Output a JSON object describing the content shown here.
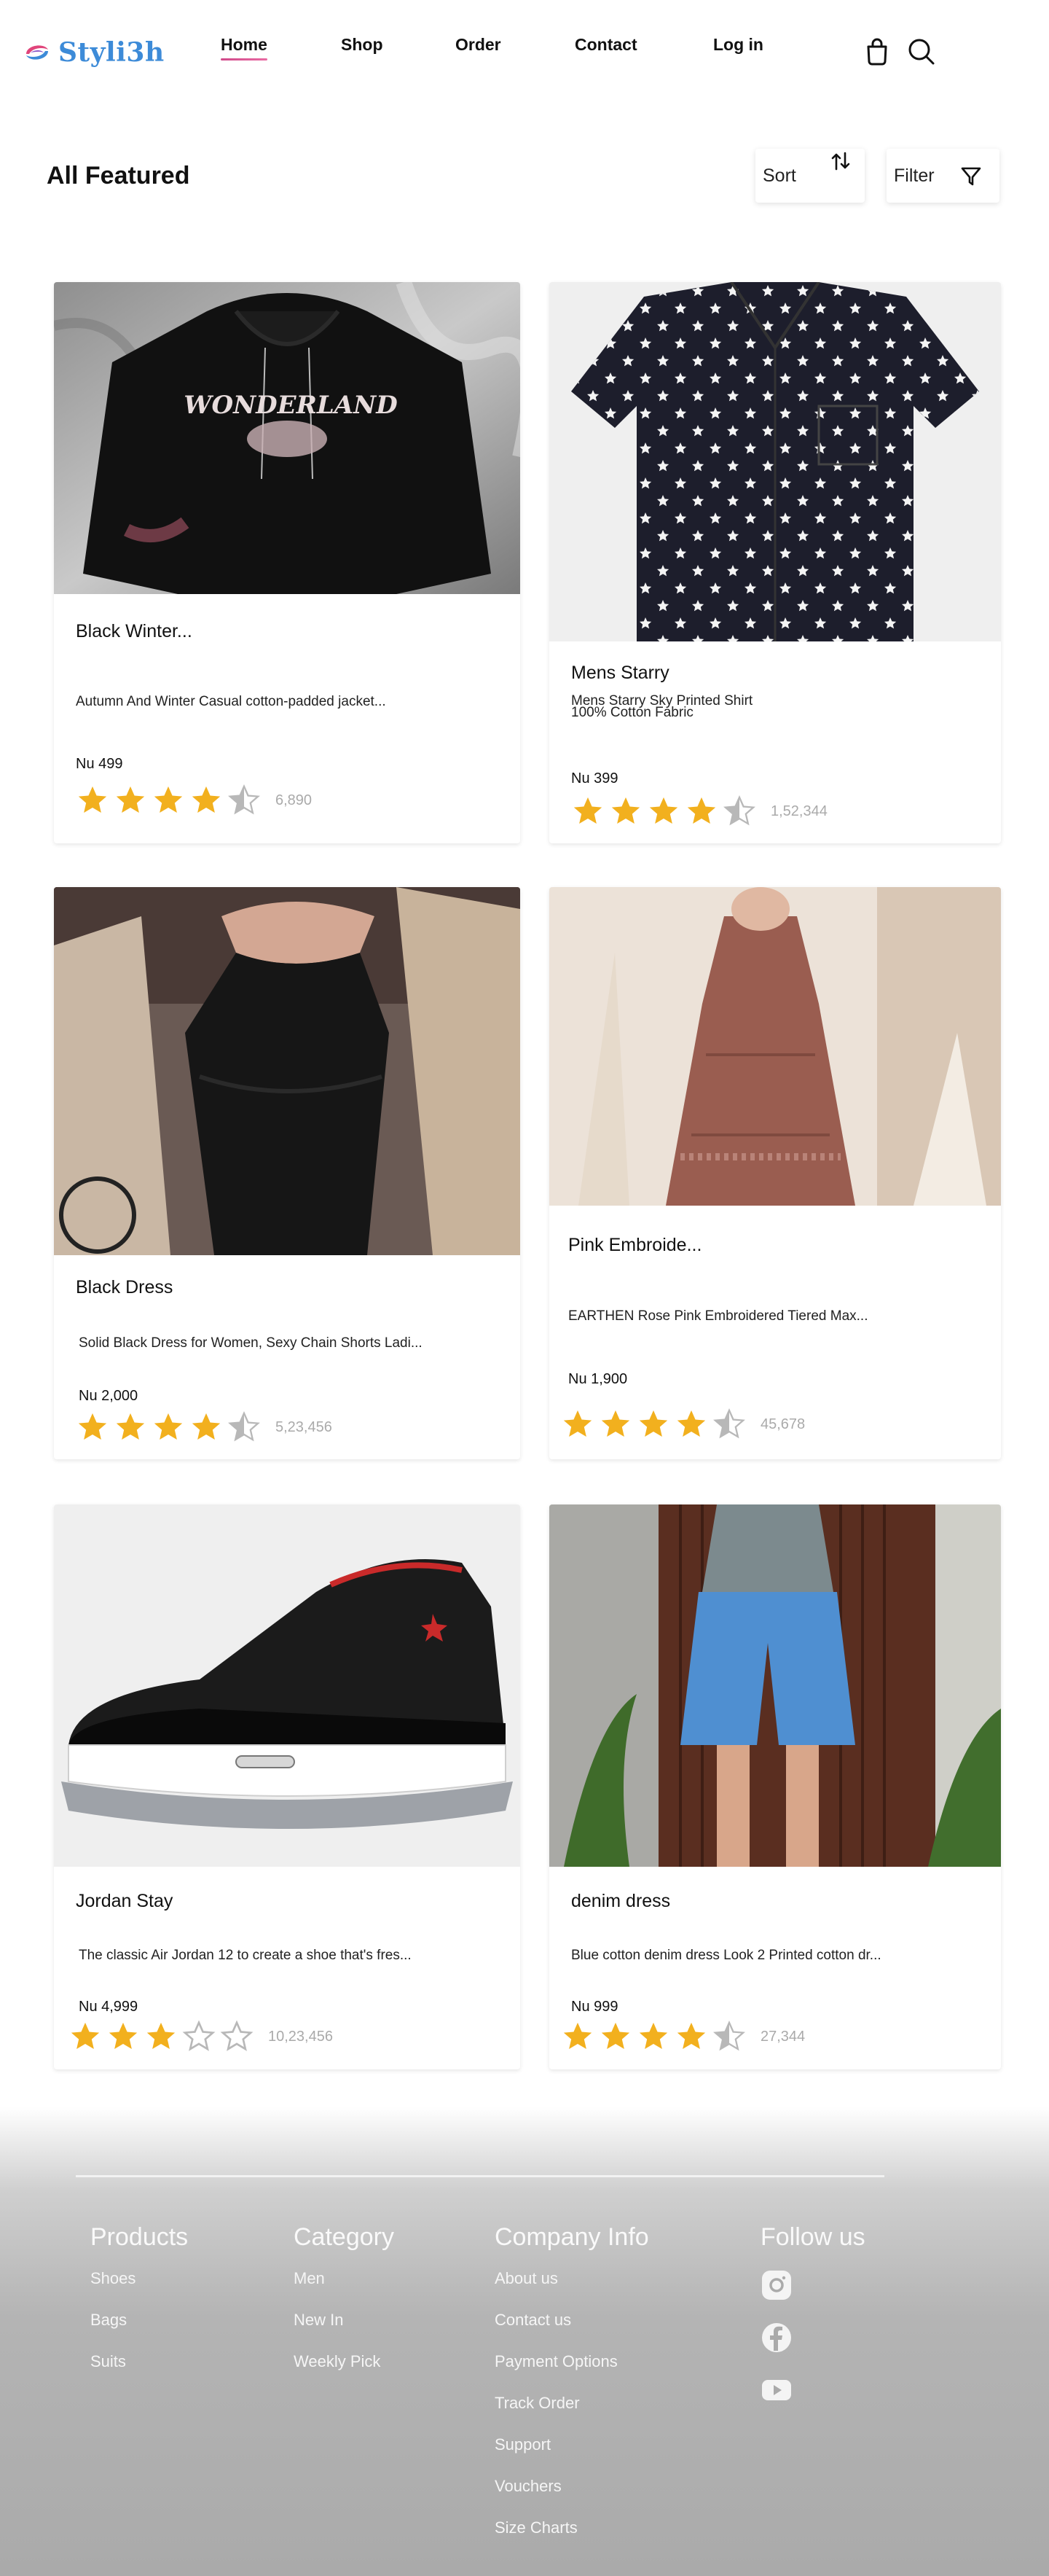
{
  "brand": {
    "name": "Styli3h"
  },
  "nav": {
    "links": [
      {
        "label": "Home",
        "active": true
      },
      {
        "label": "Shop"
      },
      {
        "label": "Order"
      },
      {
        "label": "Contact"
      },
      {
        "label": "Log in"
      }
    ],
    "icons": [
      "shopping-bag-icon",
      "search-icon"
    ]
  },
  "page": {
    "title": "All Featured"
  },
  "controls": {
    "sort_label": "Sort",
    "filter_label": "Filter"
  },
  "colors": {
    "brand": "#3d8bd8",
    "accent": "#d04a8a",
    "star": "#f2b01e",
    "star_empty": "#b8b8b8"
  },
  "products": [
    {
      "title": "Black Winter...",
      "description": "Autumn And Winter Casual cotton-padded jacket...",
      "price": "Nu 499",
      "rating": 4.5,
      "reviews": "6,890"
    },
    {
      "title": "Mens Starry",
      "description": "Mens Starry Sky Printed Shirt",
      "description2": "100% Cotton Fabric",
      "price": "Nu 399",
      "rating": 4.5,
      "reviews": "1,52,344"
    },
    {
      "title": "Black Dress",
      "description": "Solid Black Dress for Women, Sexy Chain Shorts Ladi...",
      "price": "Nu 2,000",
      "rating": 4.5,
      "reviews": "5,23,456"
    },
    {
      "title": "Pink Embroide...",
      "description": "EARTHEN Rose Pink Embroidered Tiered Max...",
      "price": "Nu 1,900",
      "rating": 4.5,
      "reviews": "45,678"
    },
    {
      "title": "Jordan Stay",
      "description": "The classic Air Jordan 12 to create a shoe that's fres...",
      "price": "Nu 4,999",
      "rating": 3,
      "reviews": "10,23,456"
    },
    {
      "title": "denim dress",
      "description": "Blue cotton denim dress Look 2 Printed cotton dr...",
      "price": "Nu 999",
      "rating": 4.5,
      "reviews": "27,344"
    }
  ],
  "footer": {
    "products": {
      "heading": "Products",
      "links": [
        "Shoes",
        "Bags",
        "Suits"
      ]
    },
    "category": {
      "heading": "Category",
      "links": [
        "Men",
        "New In",
        "Weekly Pick"
      ]
    },
    "company": {
      "heading": "Company Info",
      "links": [
        "About us",
        "Contact us",
        "Payment Options",
        "Track Order",
        "Support",
        "Vouchers",
        "Size Charts"
      ]
    },
    "follow": {
      "heading": "Follow us",
      "icons": [
        "instagram-icon",
        "facebook-icon",
        "youtube-icon"
      ]
    }
  }
}
